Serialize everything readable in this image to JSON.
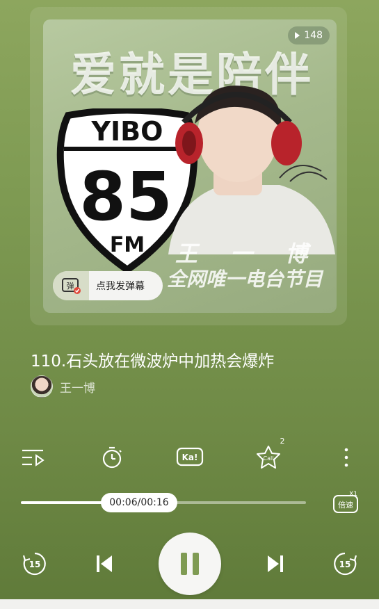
{
  "cover": {
    "play_count": "148",
    "title": "爱就是陪伴",
    "shield_top": "YIBO",
    "shield_number": "85",
    "shield_bottom": "FM",
    "host_name": "王 一 博",
    "slogan": "全网唯一电台节目"
  },
  "danmaku": {
    "icon_label": "弹",
    "button_label": "点我发弹幕"
  },
  "track": {
    "title": "110.石头放在微波炉中加热会爆炸",
    "artist": "王一博"
  },
  "actions": {
    "items": [
      {
        "name": "playlist-icon"
      },
      {
        "name": "timer-icon"
      },
      {
        "name": "karaoke-icon",
        "label": "Ka!"
      },
      {
        "name": "call-star-icon",
        "label": "Call",
        "count": "2"
      },
      {
        "name": "more-icon"
      }
    ]
  },
  "progress": {
    "current": "00:06",
    "total": "00:16",
    "display": "00:06/00:16",
    "fraction": 0.375
  },
  "speed": {
    "label": "倍速",
    "value": "X1"
  },
  "controls": {
    "rewind_seconds": "15",
    "forward_seconds": "15"
  },
  "colors": {
    "background": "#7f9b53",
    "accent": "#ffffff"
  }
}
